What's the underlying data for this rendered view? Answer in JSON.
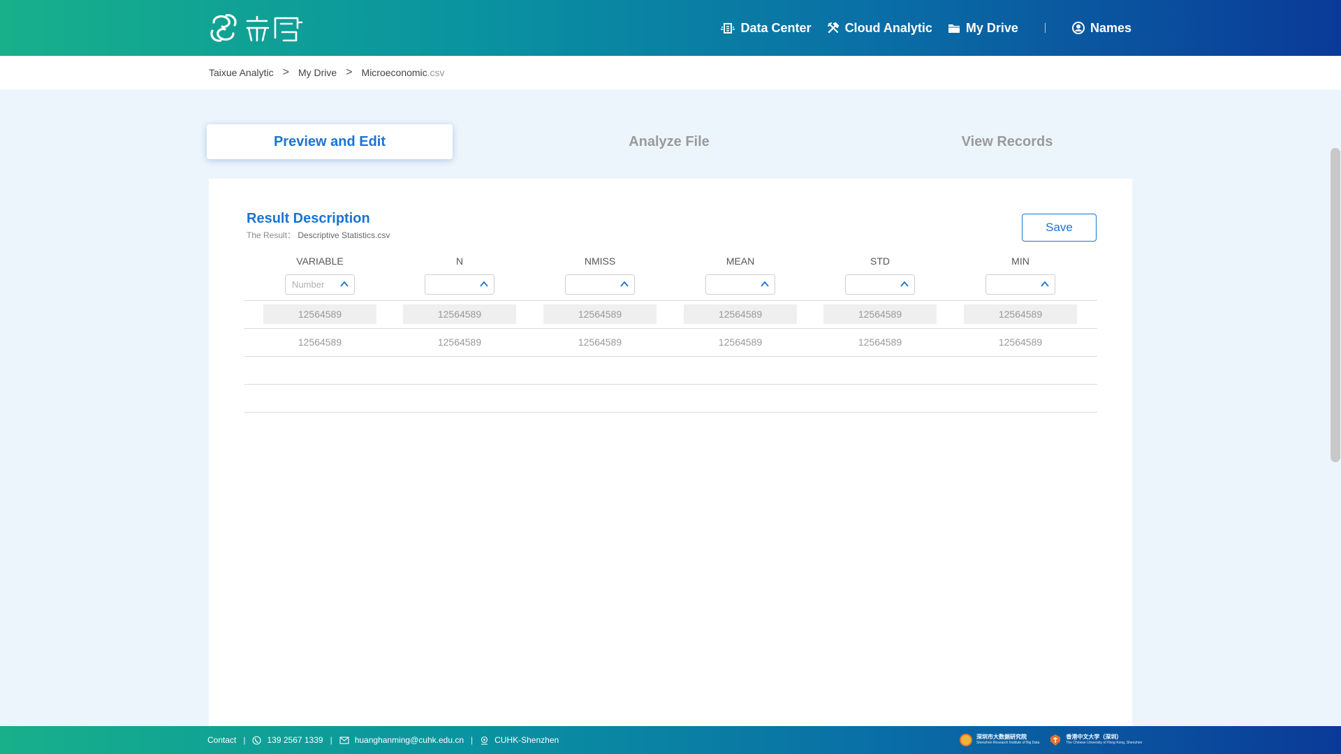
{
  "header": {
    "nav": [
      {
        "label": "Data Center",
        "icon": "data-center-icon"
      },
      {
        "label": "Cloud Analytic",
        "icon": "tools-icon"
      },
      {
        "label": "My Drive",
        "icon": "folder-icon"
      }
    ],
    "user_label": "Names"
  },
  "breadcrumb": {
    "items": [
      "Taixue Analytic",
      "My Drive"
    ],
    "separator": ">",
    "current_name": "Microeconomic",
    "current_ext": ".csv"
  },
  "tabs": [
    {
      "label": "Preview and Edit",
      "active": true
    },
    {
      "label": "Analyze File",
      "active": false
    },
    {
      "label": "View Records",
      "active": false
    }
  ],
  "panel": {
    "title": "Result Description",
    "subtitle_label": "The Result：",
    "subtitle_file": "Descriptive Statistics.csv",
    "save_label": "Save",
    "columns": [
      "VARIABLE",
      "N",
      "NMISS",
      "MEAN",
      "STD",
      "MIN"
    ],
    "filter_placeholder": "Number",
    "rows": [
      [
        "12564589",
        "12564589",
        "12564589",
        "12564589",
        "12564589",
        "12564589"
      ],
      [
        "12564589",
        "12564589",
        "12564589",
        "12564589",
        "12564589",
        "12564589"
      ]
    ]
  },
  "footer": {
    "contact_label": "Contact",
    "phone": "139 2567 1339",
    "email": "huanghanming@cuhk.edu.cn",
    "location": "CUHK-Shenzhen",
    "logos": [
      {
        "name": "深圳市大数据研究院",
        "sub": "Shenzhen Research Institute of Big Data"
      },
      {
        "name": "香港中文大学（深圳）",
        "sub": "The Chinese University of Hong Kong, Shenzhen"
      }
    ]
  },
  "colors": {
    "accent": "#1a73d4",
    "header_start": "#17b08a",
    "header_end": "#0a3a98"
  }
}
